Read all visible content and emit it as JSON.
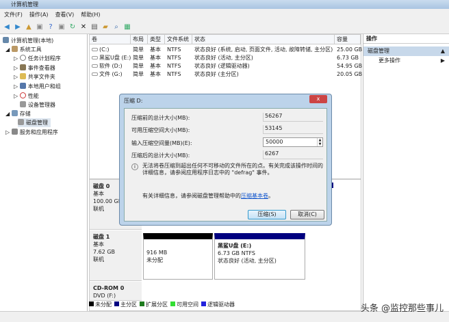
{
  "window": {
    "title": "计算机管理"
  },
  "menu": [
    "文件(F)",
    "操作(A)",
    "查看(V)",
    "帮助(H)"
  ],
  "tree": [
    {
      "label": "计算机管理(本地)",
      "indent": 0
    },
    {
      "label": "系统工具",
      "indent": 1
    },
    {
      "label": "任务计划程序",
      "indent": 2
    },
    {
      "label": "事件查看器",
      "indent": 2
    },
    {
      "label": "共享文件夹",
      "indent": 2
    },
    {
      "label": "本地用户和组",
      "indent": 2
    },
    {
      "label": "性能",
      "indent": 2
    },
    {
      "label": "设备管理器",
      "indent": 2
    },
    {
      "label": "存储",
      "indent": 1
    },
    {
      "label": "磁盘管理",
      "indent": 2
    },
    {
      "label": "服务和应用程序",
      "indent": 1
    }
  ],
  "table": {
    "headers": [
      "卷",
      "布局",
      "类型",
      "文件系统",
      "状态",
      "容量"
    ],
    "rows": [
      [
        "(C:)",
        "简单",
        "基本",
        "NTFS",
        "状态良好 (系统, 启动, 页面文件, 活动, 故障转储, 主分区)",
        "25.00 GB"
      ],
      [
        "黑鲨U盘 (E:)",
        "简单",
        "基本",
        "NTFS",
        "状态良好 (活动, 主分区)",
        "6.73 GB"
      ],
      [
        "软件 (D:)",
        "简单",
        "基本",
        "NTFS",
        "状态良好 (逻辑驱动器)",
        "54.95 GB"
      ],
      [
        "文件 (G:)",
        "简单",
        "基本",
        "NTFS",
        "状态良好 (主分区)",
        "20.05 GB"
      ]
    ]
  },
  "actions": {
    "header": "操作",
    "section": "磁盘管理",
    "more": "更多操作"
  },
  "disks": [
    {
      "name": "磁盘 0",
      "type": "基本",
      "size": "100.00 GB",
      "status": "联机"
    },
    {
      "name": "磁盘 1",
      "type": "基本",
      "size": "7.62 GB",
      "status": "联机"
    },
    {
      "name": "CD-ROM 0",
      "type": "DVD (F:)"
    }
  ],
  "disk1_parts": [
    {
      "size": "916 MB",
      "desc": "未分配"
    },
    {
      "name": "黑鲨U盘  (E:)",
      "size": "6.73 GB NTFS",
      "desc": "状态良好 (活动, 主分区)"
    }
  ],
  "legend": [
    {
      "label": "未分配",
      "color": "#000000"
    },
    {
      "label": "主分区",
      "color": "#000080"
    },
    {
      "label": "扩展分区",
      "color": "#1e7b1e"
    },
    {
      "label": "可用空间",
      "color": "#33dd33"
    },
    {
      "label": "逻辑驱动器",
      "color": "#2222dd"
    }
  ],
  "dialog": {
    "title": "压缩 D:",
    "fields": [
      {
        "label": "压缩前的总计大小(MB):",
        "value": "56267"
      },
      {
        "label": "可用压缩空间大小(MB):",
        "value": "53145"
      },
      {
        "label": "输入压缩空间量(MB)(E):",
        "value": "50000"
      },
      {
        "label": "压缩后的总计大小(MB):",
        "value": "6267"
      }
    ],
    "note": "无法将卷压缩到超出任何不可移动的文件所在的点。有关完成该操作时间的详细信息，请参阅应用程序日志中的 \"defrag\" 事件。",
    "help_prefix": "有关详细信息，请参阅磁盘管理帮助中的",
    "help_link": "压缩基本卷",
    "help_suffix": "。",
    "ok": "压缩(S)",
    "cancel": "取消(C)",
    "close": "x"
  },
  "watermark": "头条 @监控那些事儿"
}
